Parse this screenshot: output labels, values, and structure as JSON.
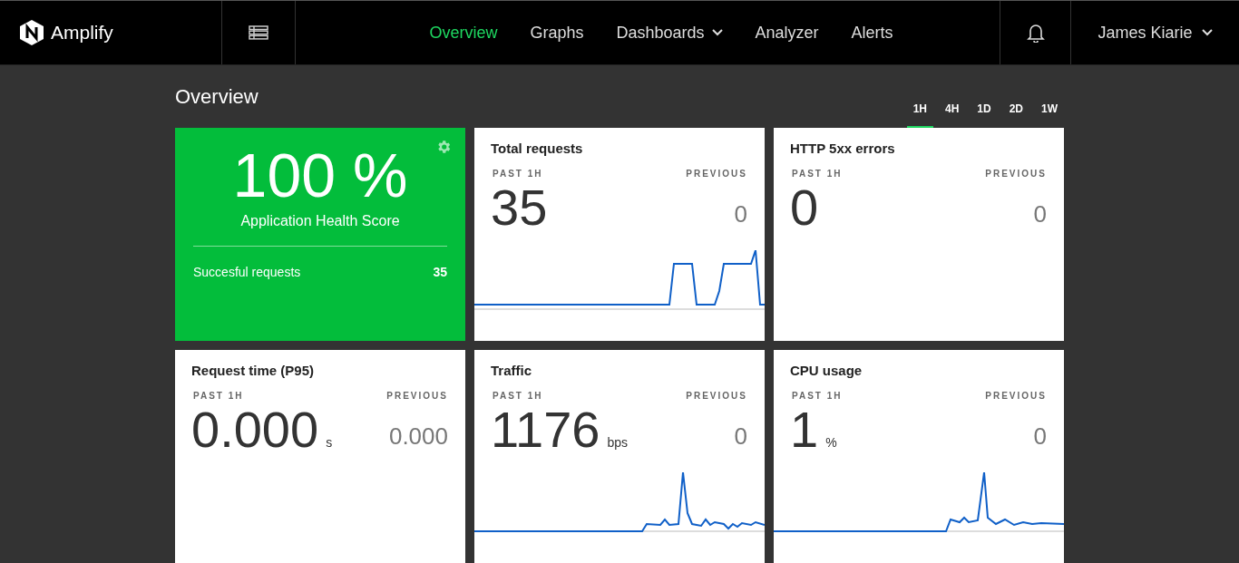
{
  "header": {
    "brand": "Amplify",
    "nav": [
      {
        "label": "Overview",
        "selected": true,
        "dropdown": false
      },
      {
        "label": "Graphs",
        "selected": false,
        "dropdown": false
      },
      {
        "label": "Dashboards",
        "selected": false,
        "dropdown": true
      },
      {
        "label": "Analyzer",
        "selected": false,
        "dropdown": false
      },
      {
        "label": "Alerts",
        "selected": false,
        "dropdown": false
      }
    ],
    "user": "James Kiarie"
  },
  "page": {
    "title": "Overview",
    "ranges": [
      {
        "label": "1H",
        "selected": true
      },
      {
        "label": "4H",
        "selected": false
      },
      {
        "label": "1D",
        "selected": false
      },
      {
        "label": "2D",
        "selected": false
      },
      {
        "label": "1W",
        "selected": false
      }
    ]
  },
  "health": {
    "score": "100 %",
    "label": "Application Health Score",
    "rows": [
      {
        "label": "Succesful requests",
        "value": "35"
      }
    ]
  },
  "cards": [
    {
      "title": "Total requests",
      "period_label": "PAST 1H",
      "previous_label": "PREVIOUS",
      "value": "35",
      "previous": "0",
      "sparkline": true
    },
    {
      "title": "HTTP 5xx errors",
      "period_label": "PAST 1H",
      "previous_label": "PREVIOUS",
      "value": "0",
      "previous": "0",
      "sparkline": false
    },
    {
      "title": "Request time (P95)",
      "period_label": "PAST 1H",
      "previous_label": "PREVIOUS",
      "value": "0.000",
      "unit": "s",
      "previous": "0.000",
      "sparkline": false
    },
    {
      "title": "Traffic",
      "period_label": "PAST 1H",
      "previous_label": "PREVIOUS",
      "value": "1176",
      "unit": "bps",
      "previous": "0",
      "sparkline": true
    },
    {
      "title": "CPU usage",
      "period_label": "PAST 1H",
      "previous_label": "PREVIOUS",
      "value": "1",
      "unit": "%",
      "previous": "0",
      "sparkline": true
    }
  ]
}
